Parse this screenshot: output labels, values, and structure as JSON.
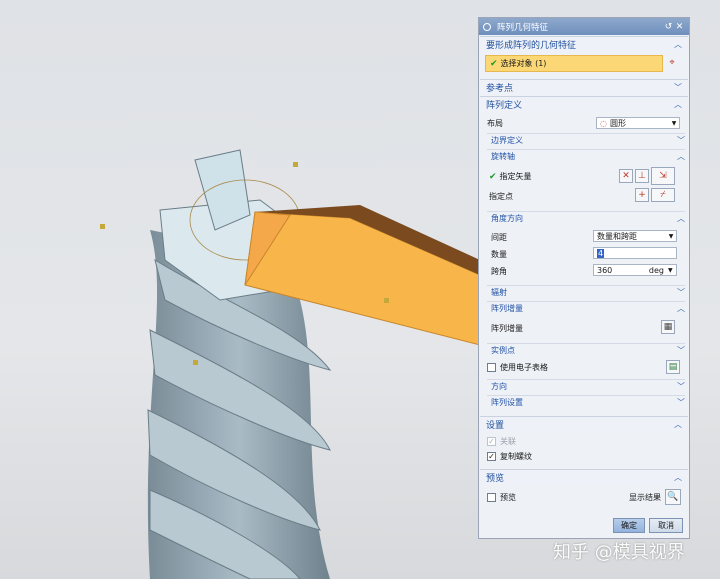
{
  "dialog": {
    "title": "阵列几何特征",
    "sections": {
      "geometry": "要形成阵列的几何特征",
      "select_object": "选择对象 (1)",
      "reference_point": "参考点",
      "pattern_definition": "阵列定义",
      "layout_label": "布局",
      "layout_value": "圆形",
      "boundary": "边界定义",
      "rotation_axis": "旋转轴",
      "specify_vector": "指定矢量",
      "specify_point": "指定点",
      "angle_direction": "角度方向",
      "spacing_label": "间距",
      "spacing_value": "数量和跨距",
      "count_label": "数量",
      "count_value": "4",
      "span_label": "跨角",
      "span_value": "360",
      "span_unit": "deg",
      "radiation": "辐射",
      "pattern_increment": "阵列增量",
      "pattern_increment_row": "阵列增量",
      "instance_points": "实例点",
      "use_spreadsheet": "使用电子表格",
      "orientation": "方向",
      "pattern_settings": "阵列设置",
      "settings": "设置",
      "associative": "关联",
      "copy_threads": "复制螺纹",
      "preview": "预览",
      "preview_check": "预览",
      "show_result": "显示结果"
    },
    "ok": "确定",
    "cancel": "取消"
  },
  "watermark": "知乎 @模具视界",
  "colors": {
    "accent": "#1f4e9c",
    "selection": "#fbd776",
    "extrude": "#f7b54a"
  }
}
